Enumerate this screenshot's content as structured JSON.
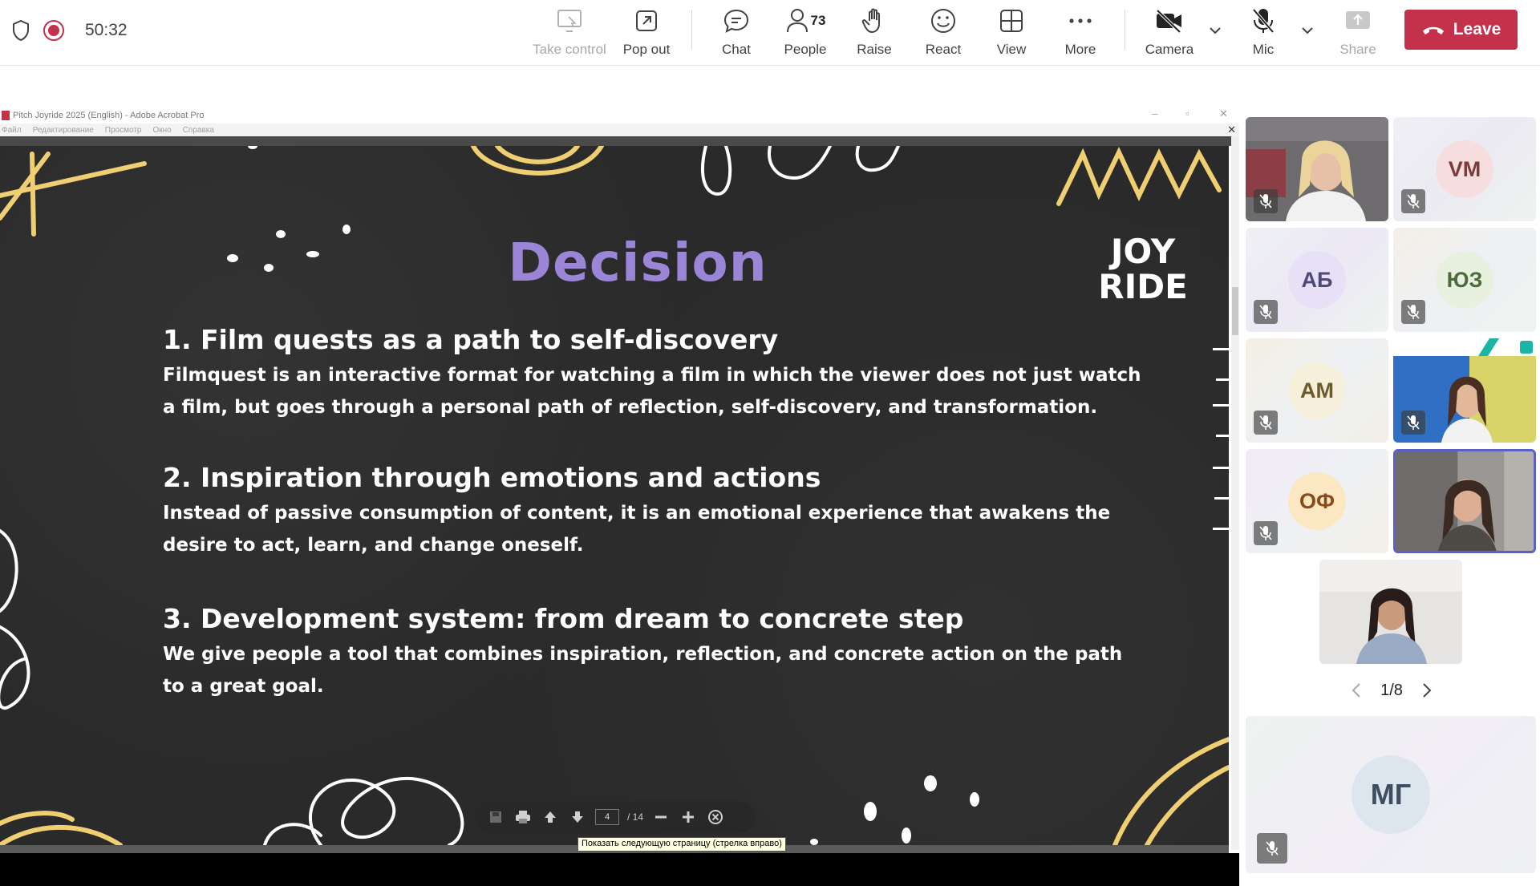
{
  "meeting": {
    "timer": "50:32",
    "buttons": {
      "take_control": "Take control",
      "pop_out": "Pop out",
      "chat": "Chat",
      "people": "People",
      "people_count": "73",
      "raise": "Raise",
      "react": "React",
      "view": "View",
      "more": "More",
      "camera": "Camera",
      "mic": "Mic",
      "share": "Share",
      "leave": "Leave"
    }
  },
  "acrobat": {
    "window_title": "Pitch Joyride 2025 (English) - Adobe Acrobat Pro",
    "menu": [
      "Файл",
      "Редактирование",
      "Просмотр",
      "Окно",
      "Справка"
    ],
    "page_current": "4",
    "page_total": "/ 14",
    "tooltip": "Показать следующую страницу (стрелка вправо)"
  },
  "slide": {
    "title": "Decision",
    "logo_line1": "JOY",
    "logo_line2": "RIDE",
    "points": [
      {
        "heading": "1. Film quests as a path to self-discovery",
        "body": "Filmquest is an interactive format for watching a film in which the viewer does not just watch a film, but goes through a personal path of reflection, self-discovery, and transformation."
      },
      {
        "heading": "2. Inspiration through emotions and actions",
        "body": " Instead of passive consumption of content, it is an emotional experience that awakens the desire to act, learn, and change oneself."
      },
      {
        "heading": "3. Development system: from dream to concrete step",
        "body": " We give people a tool that combines inspiration, reflection, and concrete action on the path to a great goal."
      }
    ]
  },
  "participants": {
    "tiles": [
      {
        "initials": "VM",
        "color": "#f6dede"
      },
      {
        "initials": "АБ",
        "color": "#e8e0f6"
      },
      {
        "initials": "ЮЗ",
        "color": "#e8f0df"
      },
      {
        "initials": "АМ",
        "color": "#f5efdc"
      },
      {
        "initials": "ОФ",
        "color": "#fbe8c2"
      },
      {
        "initials": "МГ",
        "color": "#dde6ee"
      }
    ],
    "page": "1/8"
  }
}
